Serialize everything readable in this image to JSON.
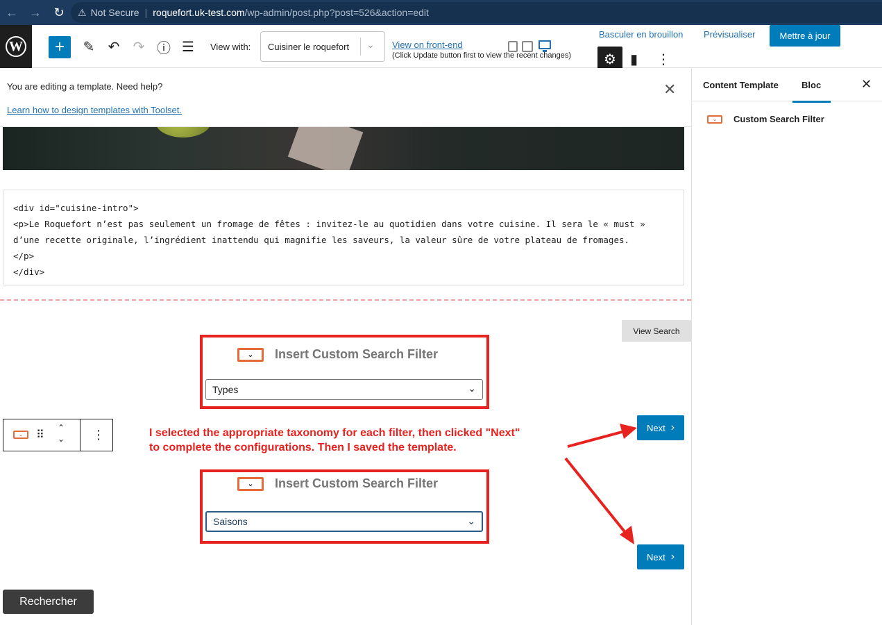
{
  "browser": {
    "back_icon": "←",
    "forward_icon": "→",
    "reload_icon": "↻",
    "warning_icon": "⚠",
    "not_secure": "Not Secure",
    "separator": "|",
    "url_host": "roquefort.uk-test.com",
    "url_path": "/wp-admin/post.php?post=526&action=edit"
  },
  "toolbar": {
    "logo_letter": "W",
    "add_icon": "+",
    "edit_icon": "✎",
    "undo_icon": "↶",
    "redo_icon": "↷",
    "info_icon": "ⓘ",
    "list_icon": "☰",
    "view_with_label": "View with:",
    "view_with_value": "Cuisiner le roquefort",
    "view_with_chevron": "⌄",
    "view_frontend_link": "View on front-end",
    "view_frontend_note": "(Click Update button first to view the recent changes)",
    "switch_draft": "Basculer en brouillon",
    "preview": "Prévisualiser",
    "update": "Mettre à jour",
    "settings_icon": "⚙",
    "plugin_icon": "▮",
    "more_icon": "⋮"
  },
  "notice": {
    "text": "You are editing a template. Need help?",
    "link": "Learn how to design templates with Toolset.",
    "close_icon": "✕"
  },
  "html_block": {
    "code": "<div id=\"cuisine-intro\">\n<p>Le Roquefort n’est pas seulement un fromage de fêtes : invitez-le au quotidien dans votre cuisine. Il sera le « must »\nd’une recette originale, l’ingrédient inattendu qui magnifie les saveurs, la valeur sûre de votre plateau de fromages.\n</p>\n</div>"
  },
  "view_search_button": "View Search",
  "filters": [
    {
      "title": "Insert Custom Search Filter",
      "selected": "Types",
      "next": "Next",
      "chevron": "⌄",
      "next_chevron": "›",
      "icon_chevron": "⌄"
    },
    {
      "title": "Insert Custom Search Filter",
      "selected": "Saisons",
      "next": "Next",
      "chevron": "⌄",
      "next_chevron": "›",
      "icon_chevron": "⌄"
    }
  ],
  "block_toolbar": {
    "drag_icon": "⠿",
    "move_up_icon": "⌃",
    "move_down_icon": "⌄",
    "more_icon": "⋮",
    "block_icon_chevron": "⌄"
  },
  "annotation": {
    "line1": "I selected the appropriate taxonomy for each filter, then clicked \"Next\"",
    "line2": "to complete the configurations. Then I saved the template.",
    "color": "#e8231f"
  },
  "search_button": "Rechercher",
  "sidebar": {
    "tabs": [
      {
        "label": "Content Template"
      },
      {
        "label": "Bloc"
      }
    ],
    "close_icon": "✕",
    "block_name": "Custom Search Filter",
    "block_icon_chevron": "⌄"
  },
  "colors": {
    "accent": "#007cba",
    "highlight": "#e8231f",
    "block_icon": "#e26d3b"
  }
}
